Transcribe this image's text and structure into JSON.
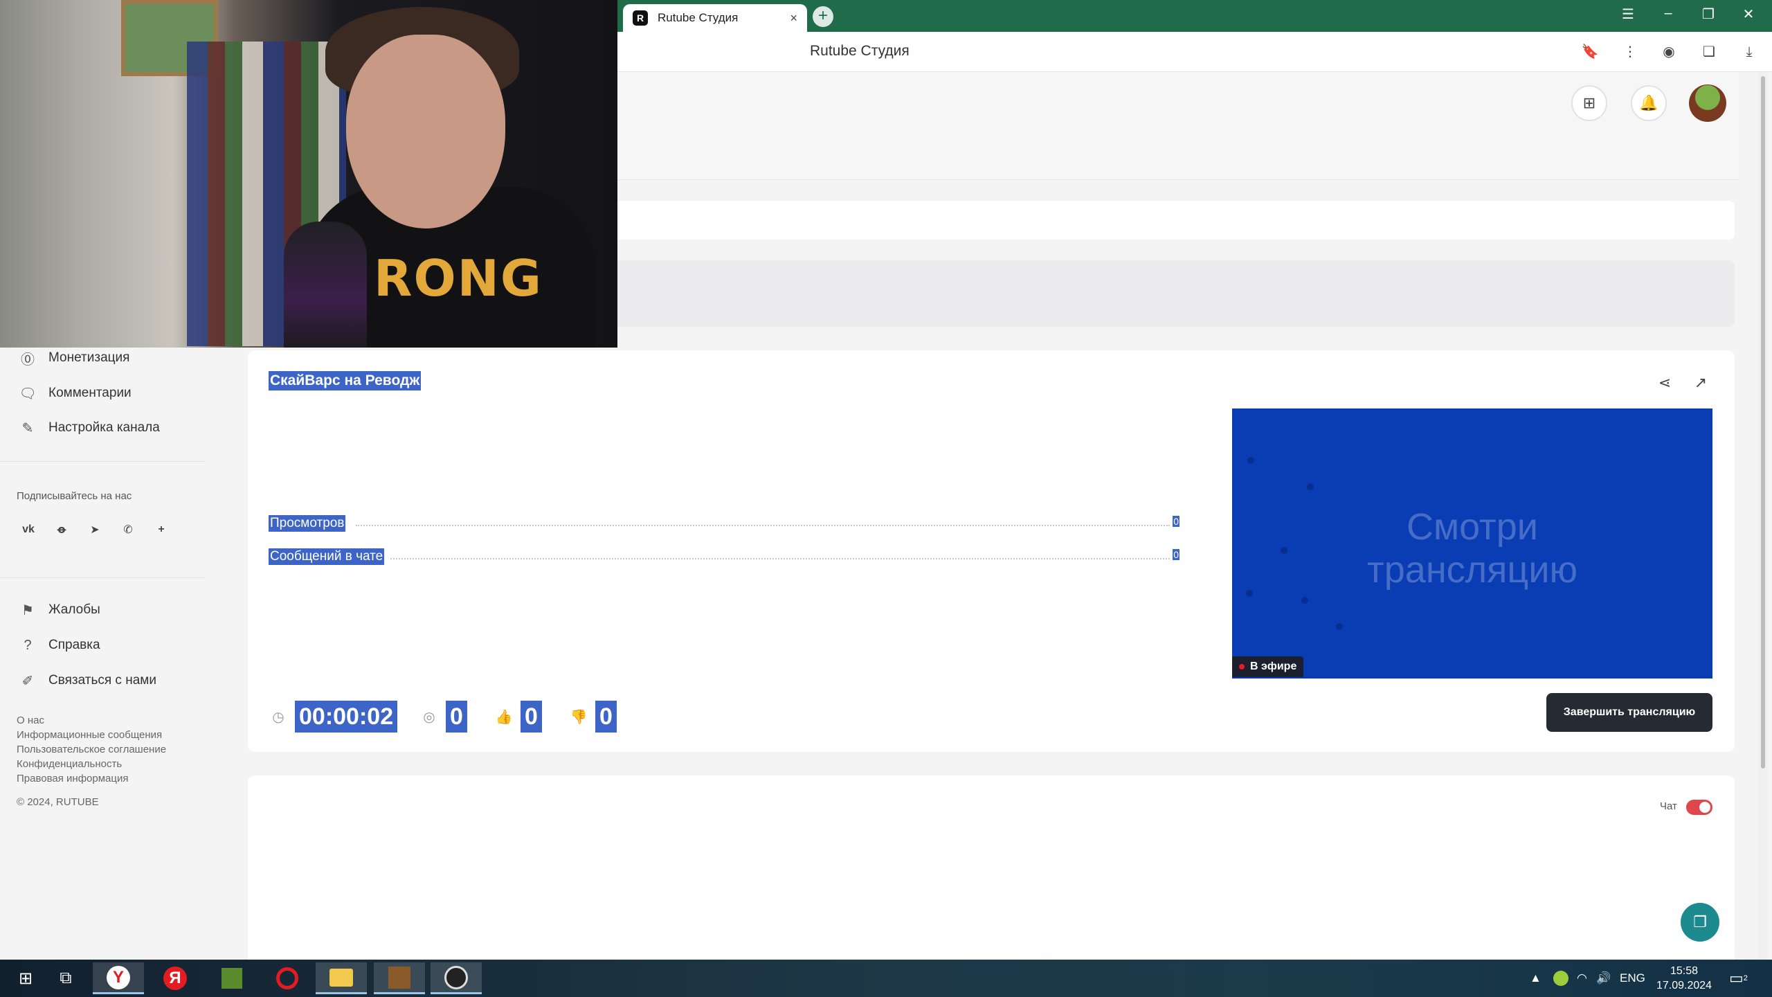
{
  "browser": {
    "tab_title": "Rutube Студия",
    "tab_favicon": "R",
    "address_title": "Rutube Студия",
    "new_tab_symbol": "+",
    "tab_close_symbol": "×"
  },
  "sidebar": {
    "items_top": [
      {
        "label": "Монетизация",
        "icon": "monetization-icon"
      },
      {
        "label": "Комментарии",
        "icon": "comments-icon"
      },
      {
        "label": "Настройка канала",
        "icon": "magic-wand-icon"
      }
    ],
    "follow_label": "Подписывайтесь на нас",
    "socials": [
      "vk",
      "ok",
      "telegram",
      "viber",
      "more"
    ],
    "items_bottom": [
      {
        "label": "Жалобы",
        "icon": "flag-icon"
      },
      {
        "label": "Справка",
        "icon": "help-icon"
      },
      {
        "label": "Связаться с нами",
        "icon": "pencil-icon"
      }
    ],
    "footer_links": [
      "О нас",
      "Информационные сообщения",
      "Пользовательское соглашение",
      "Конфиденциальность",
      "Правовая информация"
    ],
    "copyright": "© 2024, RUTUBE"
  },
  "stream": {
    "title": "СкайВарс на Реводж",
    "stats": [
      {
        "label": "Просмотров",
        "value": "0"
      },
      {
        "label": "Сообщений в чате",
        "value": "0"
      }
    ],
    "duration": "00:00:02",
    "viewers": "0",
    "likes": "0",
    "dislikes": "0",
    "preview_watermark_line1": "Смотри",
    "preview_watermark_line2": "трансляцию",
    "live_badge": "В эфире",
    "end_button": "Завершить трансляцию"
  },
  "chat": {
    "label": "Чат",
    "enabled": true
  },
  "webcam": {
    "shirt_print": "RONG"
  },
  "taskbar": {
    "lang": "ENG",
    "time": "15:58",
    "date": "17.09.2024",
    "notification_count": "2"
  },
  "colors": {
    "accent_blue": "#3d65c7",
    "preview_blue": "#0a3db3",
    "tabbar_green": "#1f6b4a",
    "toggle_red": "#e0474c",
    "fab_teal": "#1d8a8f"
  }
}
